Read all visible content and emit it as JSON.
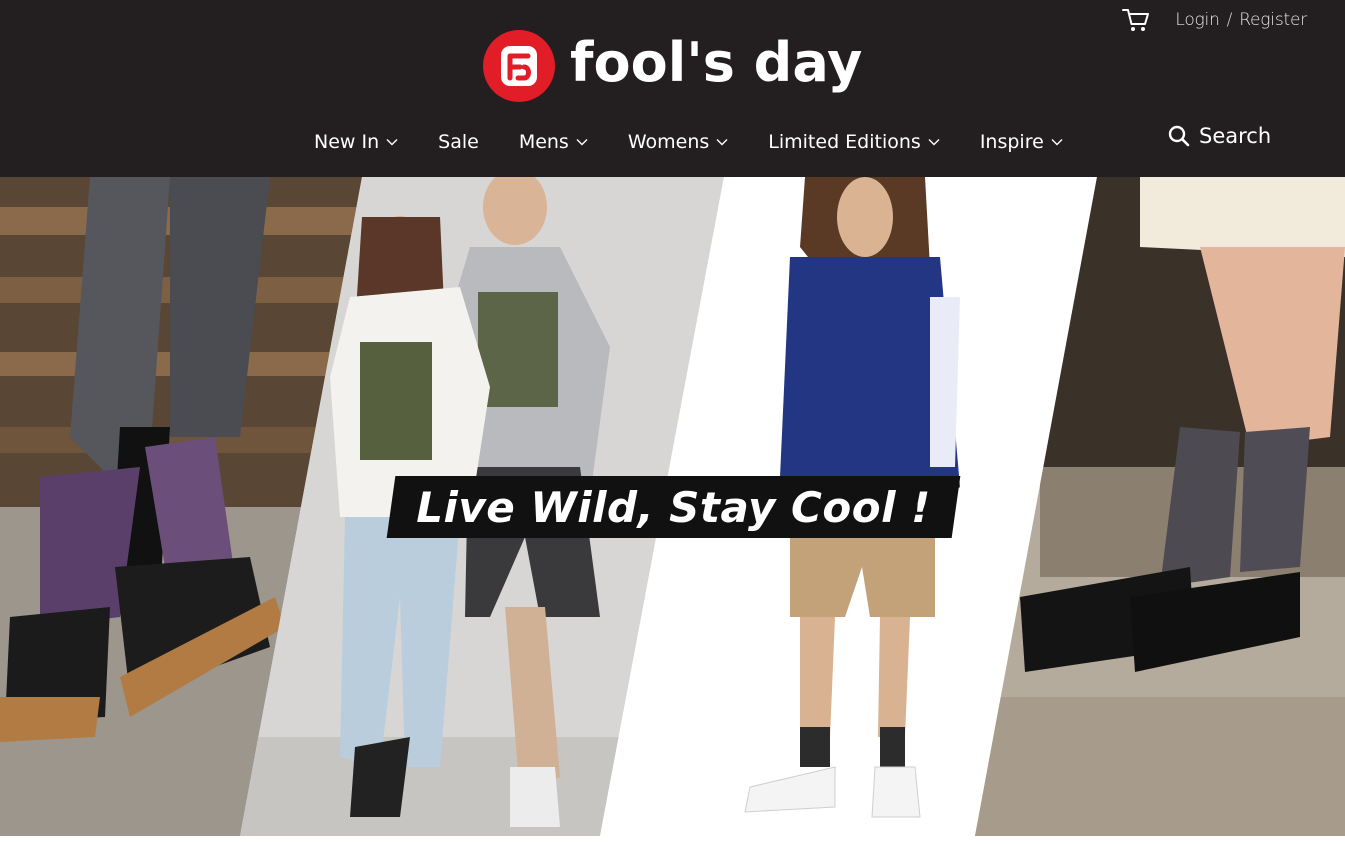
{
  "header": {
    "brand": {
      "name": "fool's day",
      "mark_color": "#e11d27"
    },
    "cart": {
      "icon": "shopping-cart-icon"
    },
    "account": {
      "login_label": "Login",
      "separator": "/",
      "register_label": "Register"
    },
    "nav": [
      {
        "label": "New In",
        "has_dropdown": true
      },
      {
        "label": "Sale",
        "has_dropdown": false
      },
      {
        "label": "Mens",
        "has_dropdown": true
      },
      {
        "label": "Womens",
        "has_dropdown": true
      },
      {
        "label": "Limited Editions",
        "has_dropdown": true
      },
      {
        "label": "Inspire",
        "has_dropdown": true
      }
    ],
    "search": {
      "label": "Search",
      "icon": "search-icon"
    }
  },
  "hero": {
    "headline": "Live Wild, Stay Cool !",
    "panels": [
      {
        "subject": "patterned socks with sandals on wooden pallets"
      },
      {
        "subject": "couple in WILD camouflage t-shirts"
      },
      {
        "subject": "model in navy hooded jacket and shorts"
      },
      {
        "subject": "rose print socks with black brogues"
      }
    ]
  },
  "colors": {
    "header_bg": "#231f20",
    "brand_red": "#e11d27",
    "text_light": "#ffffff",
    "cta_bg": "#111111"
  }
}
